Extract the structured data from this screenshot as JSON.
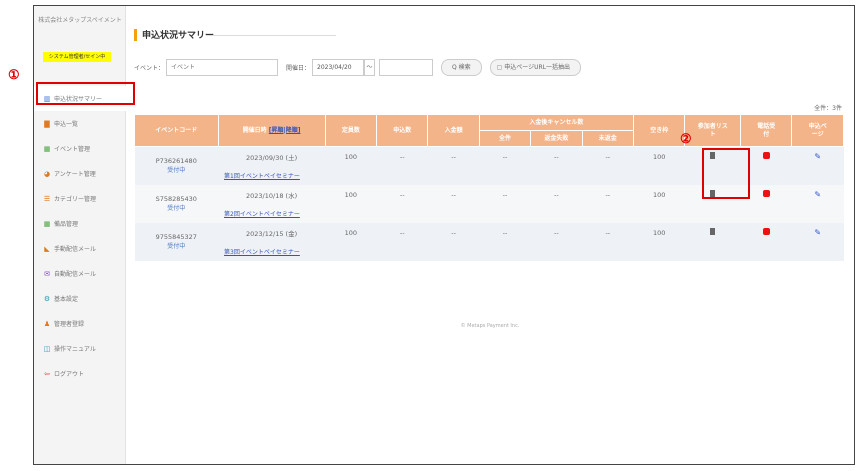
{
  "sidebar": {
    "company": "株式会社メタップスペイメント",
    "plan": "システム管理者/セイン中",
    "items": [
      {
        "label": "申込状況サマリー",
        "icon": "bar-chart-icon"
      },
      {
        "label": "申込一覧",
        "icon": "list-icon"
      },
      {
        "label": "イベント管理",
        "icon": "grid-icon"
      },
      {
        "label": "アンケート管理",
        "icon": "pie-chart-icon"
      },
      {
        "label": "カテゴリー管理",
        "icon": "menu-icon"
      },
      {
        "label": "備品管理",
        "icon": "grid-icon"
      },
      {
        "label": "手動配信メール",
        "icon": "rss-icon"
      },
      {
        "label": "自動配信メール",
        "icon": "mail-icon"
      },
      {
        "label": "基本設定",
        "icon": "gear-icon"
      },
      {
        "label": "管理者登録",
        "icon": "users-icon"
      },
      {
        "label": "操作マニュアル",
        "icon": "book-icon"
      },
      {
        "label": "ログアウト",
        "icon": "logout-icon"
      }
    ]
  },
  "main": {
    "title": "申込状況サマリー",
    "search": {
      "event_label": "イベント：",
      "event_placeholder": "イベント",
      "date_label": "開催日：",
      "date_from": "2023/04/20",
      "range_sep": "〜",
      "date_to": "",
      "search_button": "Q 検索",
      "extract_button": "申込ページURL一括抽出"
    },
    "total": "全件：3件",
    "table": {
      "headers": {
        "code": "イベントコード",
        "date": "開催日時",
        "date_sort": "[昇順|降順]",
        "capacity": "定員数",
        "applied": "申込数",
        "paid": "入金額",
        "cancel_group": "入金後キャンセル数",
        "cancel_all": "全件",
        "cancel_refund_fail": "返金失敗",
        "cancel_unrefunded": "未返金",
        "vacancy": "空き枠",
        "participants": "参加者リスト",
        "phone": "電話受付",
        "page": "申込ページ"
      },
      "rows": [
        {
          "code": "P736261480",
          "status": "受付中",
          "date": "2023/09/30 (土)",
          "capacity": "100",
          "applied": "--",
          "paid": "--",
          "cancel_all": "--",
          "cancel_refund_fail": "--",
          "cancel_unrefunded": "--",
          "vacancy": "100",
          "title": "第1回イベントペイセミナー"
        },
        {
          "code": "S758285430",
          "status": "受付中",
          "date": "2023/10/18 (水)",
          "capacity": "100",
          "applied": "--",
          "paid": "--",
          "cancel_all": "--",
          "cancel_refund_fail": "--",
          "cancel_unrefunded": "--",
          "vacancy": "100",
          "title": "第2回イベントペイセミナー"
        },
        {
          "code": "9755845327",
          "status": "受付中",
          "date": "2023/12/15 (金)",
          "capacity": "100",
          "applied": "--",
          "paid": "--",
          "cancel_all": "--",
          "cancel_refund_fail": "--",
          "cancel_unrefunded": "--",
          "vacancy": "100",
          "title": "第3回イベントペイセミナー"
        }
      ]
    },
    "footer": "© Metaps Payment Inc."
  },
  "annotations": {
    "one": "①",
    "two": "②"
  },
  "colors": {
    "accent": "#f7a10a",
    "header_bg": "#f4b48a",
    "annotation": "#e00000"
  }
}
